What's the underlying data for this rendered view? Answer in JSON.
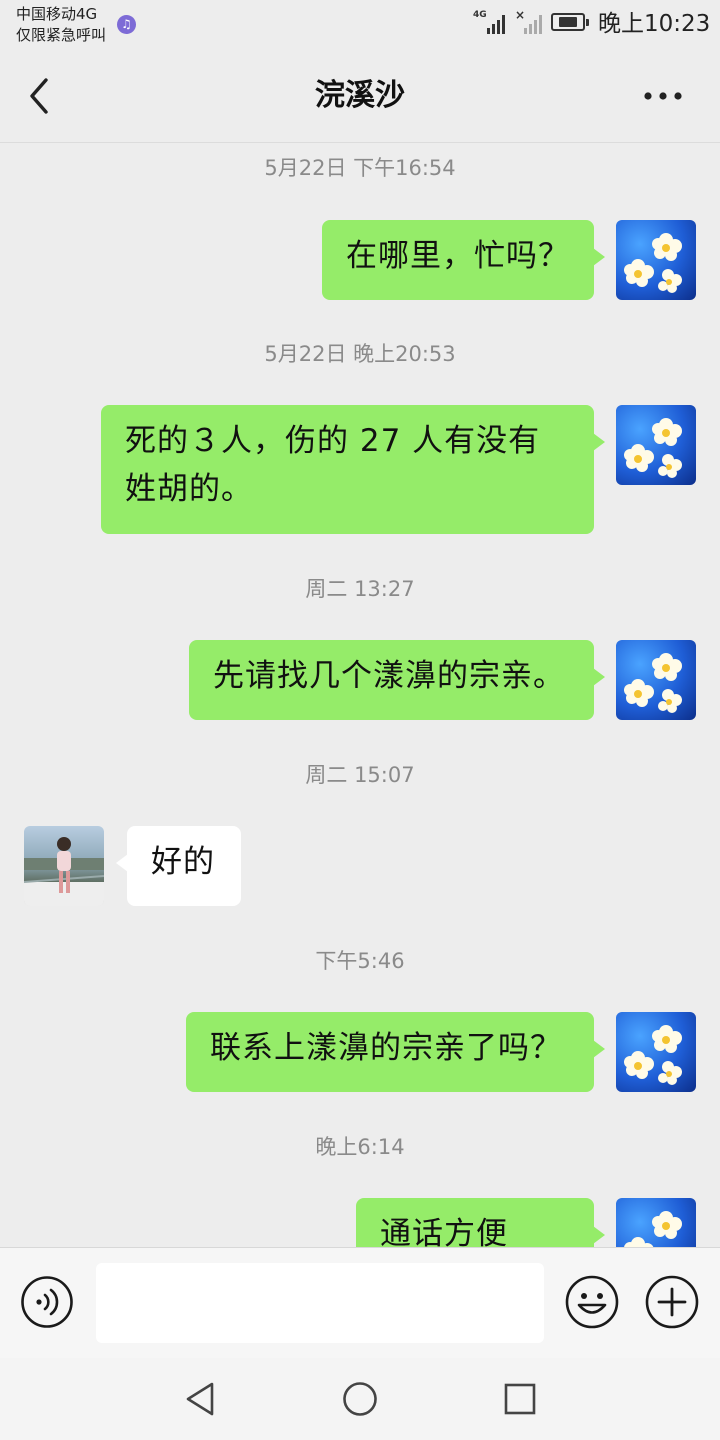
{
  "status_bar": {
    "carrier": "中国移动4G",
    "carrier_note": "仅限紧急呼叫",
    "network_label": "4G",
    "time": "晚上10:23"
  },
  "header": {
    "title": "浣溪沙"
  },
  "messages": [
    {
      "type": "time",
      "text": "5月22日 下午16:54"
    },
    {
      "type": "out",
      "text": "在哪里，忙吗？"
    },
    {
      "type": "time",
      "text": "5月22日 晚上20:53"
    },
    {
      "type": "out",
      "text": "死的３人，伤的 27 人有没有姓胡的。"
    },
    {
      "type": "time",
      "text": "周二 13:27"
    },
    {
      "type": "out",
      "text": "先请找几个漾濞的宗亲。"
    },
    {
      "type": "time",
      "text": "周二 15:07"
    },
    {
      "type": "in",
      "text": "好的"
    },
    {
      "type": "time",
      "text": "下午5:46"
    },
    {
      "type": "out",
      "text": "联系上漾濞的宗亲了吗？"
    },
    {
      "type": "time",
      "text": "晚上6:14"
    },
    {
      "type": "out",
      "text": "通话方便吗？"
    }
  ],
  "input": {
    "value": "",
    "placeholder": ""
  },
  "icons": {
    "back": "chevron-left-icon",
    "more": "more-dots-icon",
    "voice": "voice-icon",
    "emoji": "emoji-icon",
    "plus": "plus-icon",
    "nav_back": "nav-back-icon",
    "nav_home": "nav-home-icon",
    "nav_recent": "nav-recent-icon"
  },
  "colors": {
    "background": "#ededed",
    "outgoing_bubble": "#95ec69",
    "incoming_bubble": "#ffffff",
    "timestamp_text": "#8a8a8a"
  }
}
